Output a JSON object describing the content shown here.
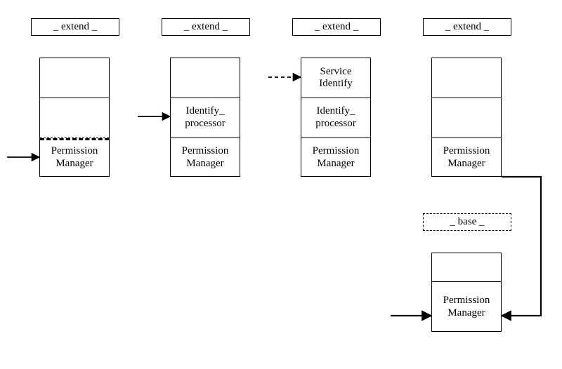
{
  "labels": {
    "extend": "_ extend _",
    "base": "_ base _"
  },
  "stacks": {
    "col1": {
      "slot1": "",
      "slot2": "",
      "slot3": "Permission\nManager"
    },
    "col2": {
      "slot1": "",
      "slot2": "Identify_\nprocessor",
      "slot3": "Permission\nManager"
    },
    "col3": {
      "slot1": "Service\nIdentify",
      "slot2": "Identify_\nprocessor",
      "slot3": "Permission\nManager"
    },
    "col4": {
      "slot1": "",
      "slot2": "",
      "slot3": "Permission\nManager"
    },
    "bottom": {
      "slot1": "",
      "slot2": "Permission\nManager"
    }
  },
  "chart_data": {
    "type": "diagram",
    "title": "",
    "description": "Four stacked module columns each labeled _extend_, progressively filling in layers (Permission Manager, Identify_processor, Service Identify). The fourth column links down to a _base_ stack containing Permission Manager. Arrows indicate composition / extension between columns.",
    "columns": [
      {
        "header": "_ extend _",
        "layers": [
          "",
          "",
          "Permission Manager"
        ],
        "arrow_into_layer_index": 2
      },
      {
        "header": "_ extend _",
        "layers": [
          "",
          "Identify_processor",
          "Permission Manager"
        ],
        "arrow_into_layer_index": 1
      },
      {
        "header": "_ extend _",
        "layers": [
          "Service Identify",
          "Identify_processor",
          "Permission Manager"
        ],
        "arrow_into_layer_index": 0,
        "arrow_style": "dashed"
      },
      {
        "header": "_ extend _",
        "layers": [
          "",
          "",
          "Permission Manager"
        ],
        "links_to_base": true
      }
    ],
    "base": {
      "header": "_ base _",
      "layers": [
        "",
        "Permission Manager"
      ]
    }
  }
}
